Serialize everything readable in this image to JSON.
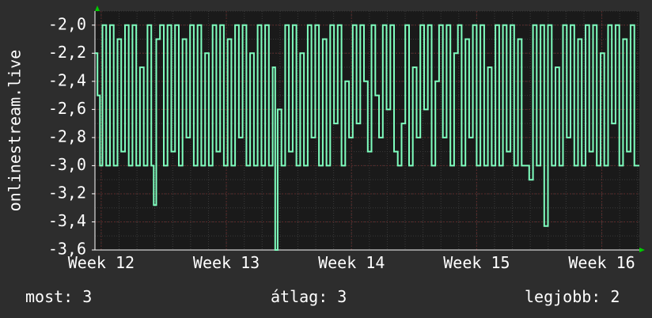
{
  "chart_data": {
    "type": "line",
    "ylabel": "onlinestream.live",
    "ylim": [
      -3.6,
      -1.9
    ],
    "yticks": [
      -2.0,
      -2.2,
      -2.4,
      -2.6,
      -2.8,
      -3.0,
      -3.2,
      -3.4,
      -3.6
    ],
    "ytick_labels": [
      "-2,0",
      "-2,2",
      "-2,4",
      "-2,6",
      "-2,8",
      "-3,0",
      "-3,2",
      "-3,4",
      "-3,6"
    ],
    "x_week_start": 11.95,
    "x_week_end": 16.3,
    "xticks": [
      12,
      13,
      14,
      15,
      16
    ],
    "xtick_labels": [
      "Week 12",
      "Week 13",
      "Week 14",
      "Week 15",
      "Week 16"
    ],
    "grid": true,
    "colors": {
      "background": "#2d2d2d",
      "plot_background": "#1a1a1a",
      "major_grid": "#5a2a2a",
      "minor_grid": "#3a3a3a",
      "line": "#7fffbf",
      "text": "#ffffff",
      "arrow": "#00cc00"
    },
    "series": [
      {
        "x": [
          11.95,
          11.97,
          11.99,
          12.01,
          12.04,
          12.07,
          12.1,
          12.13,
          12.16,
          12.19,
          12.22,
          12.25,
          12.28,
          12.31,
          12.34,
          12.37,
          12.4,
          12.42,
          12.44,
          12.47,
          12.5,
          12.53,
          12.56,
          12.59,
          12.62,
          12.65,
          12.68,
          12.71,
          12.74,
          12.77,
          12.8,
          12.83,
          12.86,
          12.89,
          12.92,
          12.95,
          12.98,
          13.01,
          13.04,
          13.07,
          13.1,
          13.13,
          13.16,
          13.19,
          13.22,
          13.25,
          13.28,
          13.31,
          13.34,
          13.37,
          13.39,
          13.41,
          13.44,
          13.47,
          13.5,
          13.53,
          13.56,
          13.59,
          13.62,
          13.65,
          13.68,
          13.71,
          13.74,
          13.77,
          13.8,
          13.83,
          13.86,
          13.89,
          13.92,
          13.95,
          13.98,
          14.01,
          14.04,
          14.07,
          14.1,
          14.13,
          14.16,
          14.19,
          14.22,
          14.25,
          14.28,
          14.31,
          14.34,
          14.37,
          14.4,
          14.43,
          14.46,
          14.49,
          14.52,
          14.55,
          14.58,
          14.61,
          14.64,
          14.67,
          14.7,
          14.73,
          14.76,
          14.79,
          14.82,
          14.85,
          14.88,
          14.91,
          14.94,
          14.97,
          15.0,
          15.03,
          15.06,
          15.09,
          15.12,
          15.15,
          15.18,
          15.21,
          15.24,
          15.27,
          15.3,
          15.33,
          15.36,
          15.39,
          15.42,
          15.45,
          15.48,
          15.51,
          15.54,
          15.57,
          15.6,
          15.63,
          15.66,
          15.69,
          15.72,
          15.75,
          15.78,
          15.81,
          15.84,
          15.87,
          15.9,
          15.93,
          15.96,
          15.99,
          16.02,
          16.05,
          16.08,
          16.11,
          16.14,
          16.17,
          16.2,
          16.23,
          16.26,
          16.29
        ],
        "values": [
          -2.2,
          -2.5,
          -3.0,
          -2.0,
          -3.0,
          -2.0,
          -3.0,
          -2.1,
          -2.9,
          -2.0,
          -3.0,
          -2.0,
          -3.0,
          -2.3,
          -3.0,
          -2.0,
          -3.0,
          -3.28,
          -2.1,
          -2.0,
          -3.0,
          -2.0,
          -2.9,
          -2.0,
          -3.0,
          -2.1,
          -2.8,
          -2.0,
          -3.0,
          -2.0,
          -3.0,
          -2.2,
          -3.0,
          -2.0,
          -2.9,
          -2.0,
          -3.0,
          -2.1,
          -3.0,
          -2.0,
          -2.8,
          -2.0,
          -3.0,
          -2.2,
          -3.0,
          -2.0,
          -3.0,
          -2.0,
          -3.0,
          -2.3,
          -3.6,
          -2.6,
          -3.0,
          -2.0,
          -2.9,
          -2.0,
          -3.0,
          -2.2,
          -3.0,
          -2.0,
          -2.8,
          -2.0,
          -3.0,
          -2.1,
          -3.0,
          -2.0,
          -2.7,
          -2.0,
          -3.0,
          -2.4,
          -2.8,
          -2.0,
          -2.7,
          -2.0,
          -2.4,
          -2.9,
          -2.0,
          -2.5,
          -2.8,
          -2.0,
          -2.6,
          -2.0,
          -2.9,
          -3.0,
          -2.7,
          -2.0,
          -3.0,
          -2.3,
          -2.8,
          -2.0,
          -2.6,
          -2.0,
          -3.0,
          -2.4,
          -2.0,
          -2.8,
          -2.0,
          -3.0,
          -2.2,
          -2.0,
          -3.0,
          -2.1,
          -2.8,
          -2.0,
          -3.0,
          -2.0,
          -3.0,
          -2.3,
          -3.0,
          -2.0,
          -3.0,
          -2.0,
          -2.9,
          -2.0,
          -3.0,
          -2.1,
          -3.0,
          -3.0,
          -3.1,
          -2.0,
          -3.0,
          -2.0,
          -3.43,
          -2.0,
          -3.0,
          -2.3,
          -3.0,
          -2.0,
          -2.8,
          -2.0,
          -3.0,
          -2.1,
          -3.0,
          -2.0,
          -2.9,
          -2.0,
          -3.0,
          -2.2,
          -3.0,
          -2.0,
          -2.7,
          -2.0,
          -3.0,
          -2.1,
          -2.9,
          -2.0,
          -3.0,
          -3.0
        ]
      }
    ]
  },
  "footer": {
    "current": "most: 3",
    "average": "átlag: 3",
    "max": "legjobb: 2"
  }
}
